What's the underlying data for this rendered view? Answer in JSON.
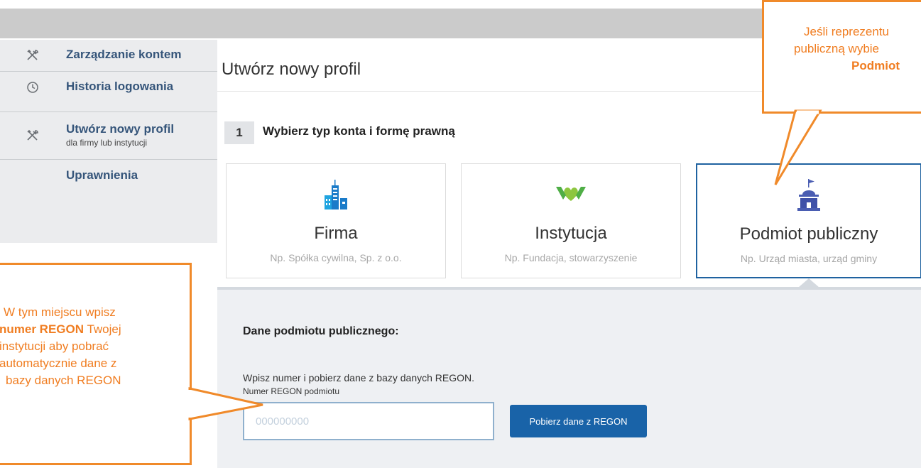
{
  "sidebar": {
    "items": [
      {
        "icon": "tools-icon",
        "label": "Zarządzanie kontem"
      },
      {
        "icon": "clock-icon",
        "label": "Historia logowania"
      },
      {
        "icon": "tools-icon",
        "label": "Utwórz nowy profil",
        "sublabel": "dla firmy lub instytucji"
      },
      {
        "icon": "",
        "label": "Uprawnienia"
      }
    ]
  },
  "main": {
    "title": "Utwórz nowy profil",
    "step": {
      "number": "1",
      "title": "Wybierz typ konta i formę prawną"
    },
    "account_types": [
      {
        "icon": "buildings-icon",
        "name": "Firma",
        "description": "Np. Spółka cywilna, Sp. z o.o.",
        "selected": false
      },
      {
        "icon": "heart-hands-icon",
        "name": "Instytucja",
        "description": "Np. Fundacja, stowarzyszenie",
        "selected": false
      },
      {
        "icon": "public-building-icon",
        "name": "Podmiot publiczny",
        "description": "Np. Urząd miasta, urząd gminy",
        "selected": true
      }
    ],
    "panel": {
      "title": "Dane podmiotu publicznego:",
      "description": "Wpisz numer i pobierz dane z bazy danych REGON.",
      "field_label": "Numer REGON podmiotu",
      "field_placeholder": "000000000",
      "button_label": "Pobierz dane z REGON"
    }
  },
  "callouts": {
    "top_right": {
      "line1": "Jeśli reprezentu",
      "line2": "publiczną wybie",
      "line3": "Podmiot"
    },
    "left": {
      "line1": "W tym miejscu wpisz",
      "line2_bold": "numer REGON",
      "line2_rest": " Twojej",
      "line3": "instytucji aby pobrać",
      "line4": "automatycznie dane z",
      "line5": "bazy danych REGON"
    }
  },
  "colors": {
    "accent": "#1963a8",
    "callout": "#f08a2a",
    "selected_border": "#1f62a0"
  }
}
